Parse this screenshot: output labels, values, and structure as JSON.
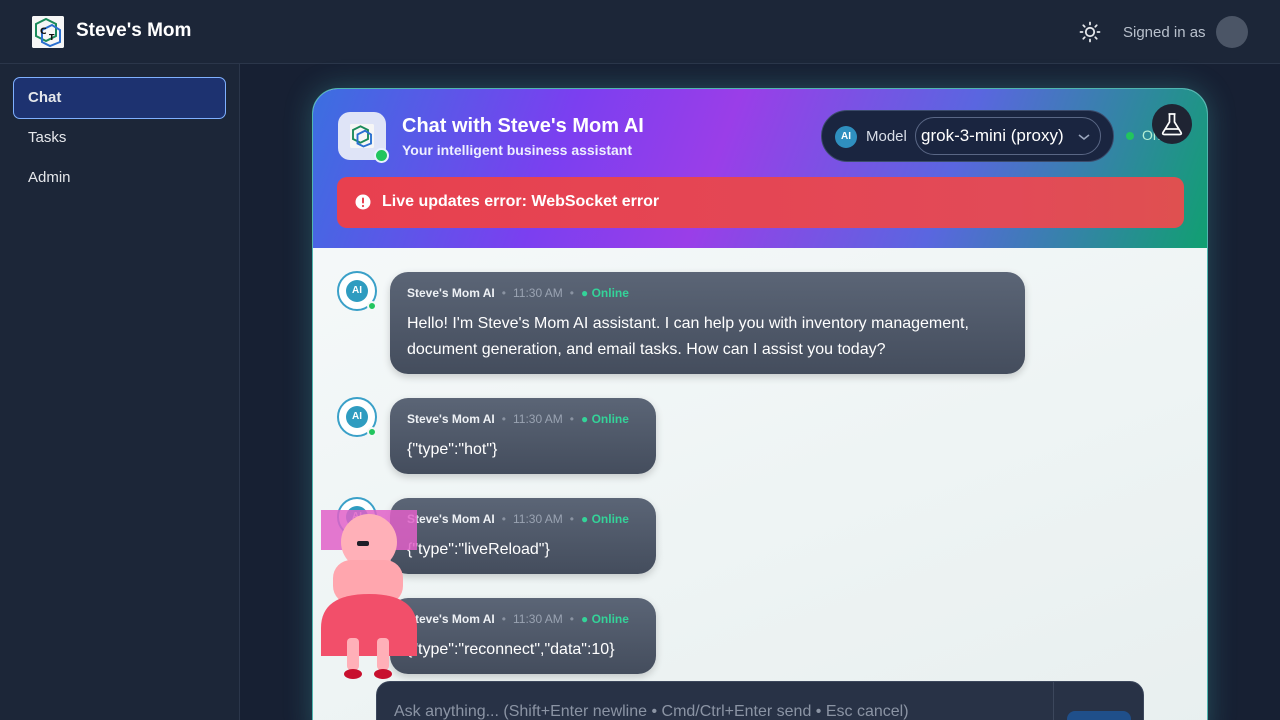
{
  "app": {
    "brand": "Steve's Mom",
    "signed_in_label": "Signed in as"
  },
  "sidebar": {
    "items": [
      {
        "label": "Chat",
        "active": true
      },
      {
        "label": "Tasks"
      },
      {
        "label": "Admin"
      }
    ]
  },
  "chat": {
    "title": "Chat with Steve's Mom AI",
    "subtitle": "Your intelligent business assistant",
    "model_badge": "AI",
    "model_label": "Model",
    "model_value": "grok-3-mini (proxy)",
    "status_text": "Online",
    "error": "Live updates error: WebSocket error",
    "avatar_label": "AI",
    "messages": [
      {
        "sender": "Steve's Mom AI",
        "time": "11:30 AM",
        "status": "Online",
        "lines": [
          "Hello! I'm Steve's Mom AI assistant. I can help you with inventory management,",
          "document generation, and email tasks. How can I assist you today?"
        ]
      },
      {
        "sender": "Steve's Mom AI",
        "time": "11:30 AM",
        "status": "Online",
        "lines": [
          "{\"type\":\"hot\"}"
        ]
      },
      {
        "sender": "Steve's Mom AI",
        "time": "11:30 AM",
        "status": "Online",
        "lines": [
          "{\"type\":\"liveReload\"}"
        ]
      },
      {
        "sender": "Steve's Mom AI",
        "time": "11:30 AM",
        "status": "Online",
        "lines": [
          "{\"type\":\"reconnect\",\"data\":10}"
        ]
      }
    ],
    "composer_placeholder": "Ask anything... (Shift+Enter newline • Cmd/Ctrl+Enter send • Esc cancel)"
  },
  "colors": {
    "accent": "#1d3270",
    "error": "#e8404f",
    "online": "#22c55e",
    "bubble": "#4f5869"
  },
  "icons": {
    "theme_toggle": "sun-icon",
    "lab": "flask-icon",
    "error": "alert-circle-icon",
    "model_dropdown": "chevron-down-icon"
  }
}
